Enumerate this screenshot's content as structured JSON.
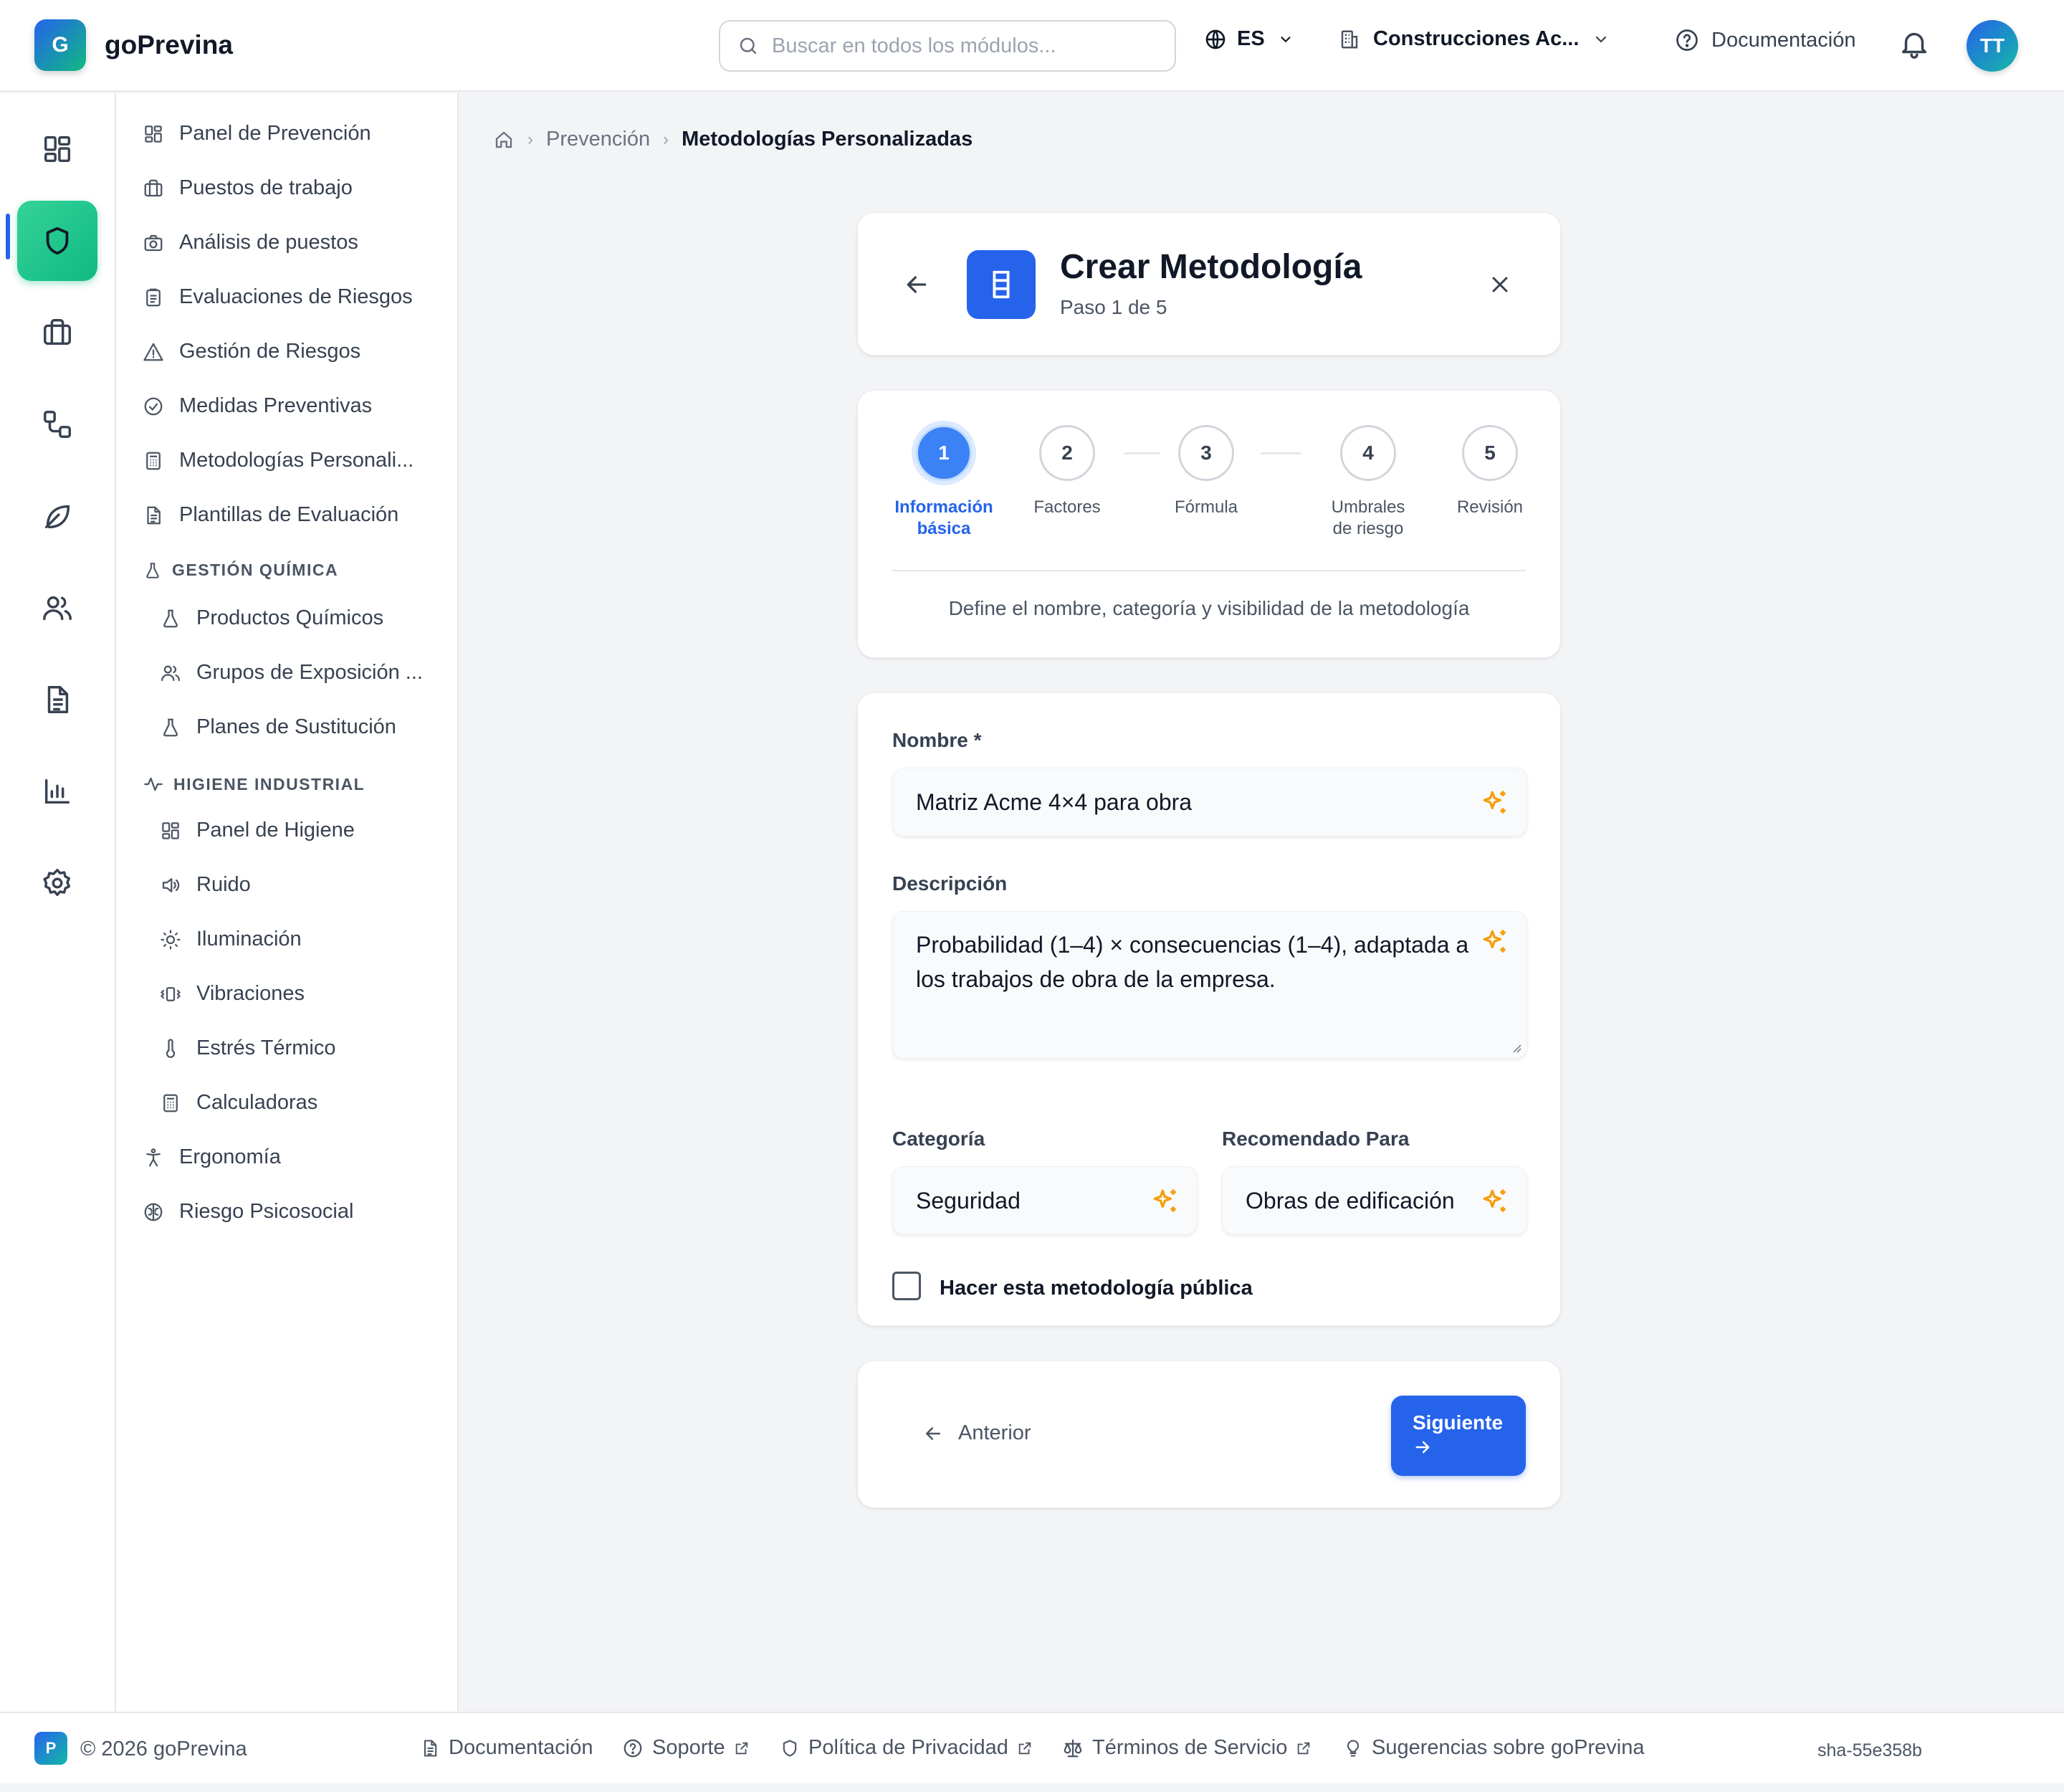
{
  "app": {
    "logo_letter": "G",
    "name": "goPrevina"
  },
  "header": {
    "search_placeholder": "Buscar en todos los módulos...",
    "language": "ES",
    "company": "Construcciones Ac...",
    "docs_label": "Documentación",
    "avatar_initials": "TT"
  },
  "rail": {
    "items": [
      {
        "name": "dashboard-icon"
      },
      {
        "name": "shield-icon",
        "active": true
      },
      {
        "name": "briefcase-icon"
      },
      {
        "name": "workflow-icon"
      },
      {
        "name": "leaf-icon"
      },
      {
        "name": "users-icon"
      },
      {
        "name": "document-icon"
      },
      {
        "name": "chart-icon"
      },
      {
        "name": "gear-icon"
      }
    ]
  },
  "sidebar": {
    "items": [
      {
        "label": "Panel de Prevención",
        "icon": "grid-icon"
      },
      {
        "label": "Puestos de trabajo",
        "icon": "briefcase-icon"
      },
      {
        "label": "Análisis de puestos",
        "icon": "camera-icon"
      },
      {
        "label": "Evaluaciones de Riesgos",
        "icon": "clipboard-icon"
      },
      {
        "label": "Gestión de Riesgos",
        "icon": "warning-icon"
      },
      {
        "label": "Medidas Preventivas",
        "icon": "check-circle-icon"
      },
      {
        "label": "Metodologías Personali...",
        "icon": "calculator-icon"
      },
      {
        "label": "Plantillas de Evaluación",
        "icon": "file-icon"
      }
    ],
    "chem_section": "GESTIÓN QUÍMICA",
    "chem_items": [
      {
        "label": "Productos Químicos",
        "icon": "flask-icon"
      },
      {
        "label": "Grupos de Exposición ...",
        "icon": "users-icon"
      },
      {
        "label": "Planes de Sustitución",
        "icon": "flask-icon"
      }
    ],
    "hyg_section": "HIGIENE INDUSTRIAL",
    "hyg_items": [
      {
        "label": "Panel de Higiene",
        "icon": "grid-icon"
      },
      {
        "label": "Ruido",
        "icon": "speaker-icon"
      },
      {
        "label": "Iluminación",
        "icon": "sun-icon"
      },
      {
        "label": "Vibraciones",
        "icon": "vibration-icon"
      },
      {
        "label": "Estrés Térmico",
        "icon": "thermometer-icon"
      },
      {
        "label": "Calculadoras",
        "icon": "calculator-icon"
      }
    ],
    "bottom_items": [
      {
        "label": "Ergonomía",
        "icon": "person-icon"
      },
      {
        "label": "Riesgo Psicosocial",
        "icon": "brain-icon"
      }
    ]
  },
  "breadcrumb": {
    "section": "Prevención",
    "current": "Metodologías Personalizadas"
  },
  "wizard": {
    "title": "Crear Metodología",
    "subtitle": "Paso 1 de 5",
    "current_step": 1,
    "steps": [
      {
        "num": "1",
        "label": "Información básica"
      },
      {
        "num": "2",
        "label": "Factores"
      },
      {
        "num": "3",
        "label": "Fórmula"
      },
      {
        "num": "4",
        "label": "Umbrales de riesgo"
      },
      {
        "num": "5",
        "label": "Revisión"
      }
    ],
    "step_description": "Define el nombre, categoría y visibilidad de la metodología"
  },
  "form": {
    "name_label": "Nombre *",
    "name_value": "Matriz Acme 4×4 para obra",
    "description_label": "Descripción",
    "description_value": "Probabilidad (1–4) × consecuencias (1–4), adaptada a los trabajos de obra de la empresa.",
    "category_label": "Categoría",
    "category_value": "Seguridad",
    "recommended_label": "Recomendado Para",
    "recommended_value": "Obras de edificación",
    "public_label": "Hacer esta metodología pública",
    "public_checked": false
  },
  "nav": {
    "prev_label": "Anterior",
    "next_label": "Siguiente"
  },
  "footer": {
    "logo_letter": "P",
    "copyright": "© 2026 goPrevina",
    "docs": "Documentación",
    "support": "Soporte",
    "privacy": "Política de Privacidad",
    "terms": "Términos de Servicio",
    "suggestions": "Sugerencias sobre goPrevina",
    "sha": "sha-55e358b"
  },
  "colors": {
    "primary": "#2563eb",
    "active_rail": "#10b981",
    "sparkle": "#f59e0b"
  }
}
